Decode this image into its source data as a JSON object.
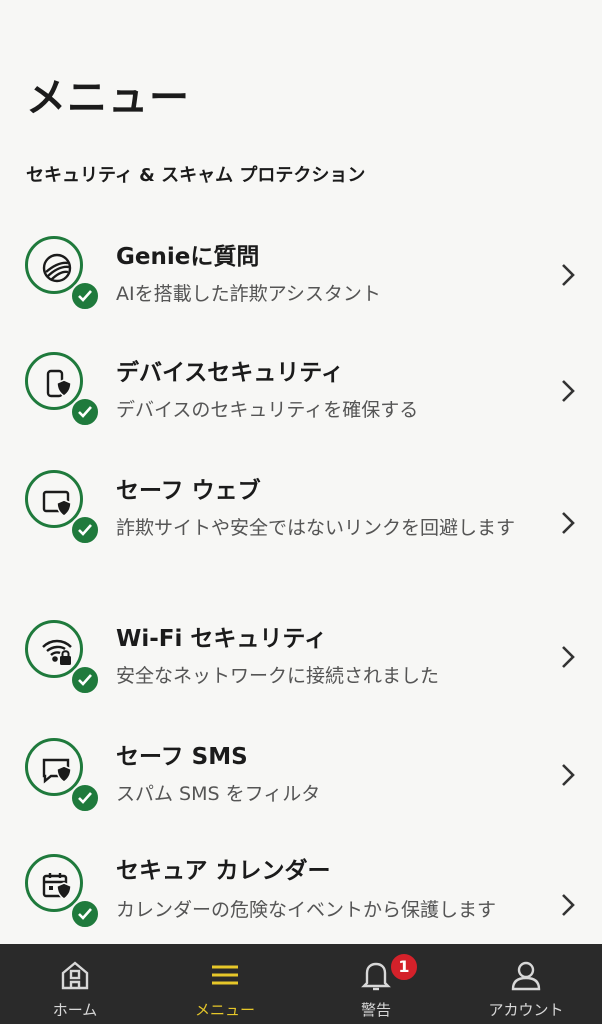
{
  "header": {
    "title": "メニュー",
    "section": "セキュリティ & スキャム プロテクション"
  },
  "colors": {
    "accent_green": "#1f7a3c",
    "nav_background": "#2a2a2a",
    "nav_active": "#e6c729",
    "badge_red": "#d4212a"
  },
  "menu": [
    {
      "title": "Genieに質問",
      "desc": "AIを搭載した詐欺アシスタント",
      "icon": "genie-icon"
    },
    {
      "title": "デバイスセキュリティ",
      "desc": "デバイスのセキュリティを確保する",
      "icon": "device-shield-icon"
    },
    {
      "title": "セーフ ウェブ",
      "desc": "詐欺サイトや安全ではないリンクを回避します",
      "icon": "web-shield-icon"
    },
    {
      "title": "Wi-Fi セキュリティ",
      "desc": "安全なネットワークに接続されました",
      "icon": "wifi-lock-icon"
    },
    {
      "title": "セーフ SMS",
      "desc": "スパム SMS をフィルタ",
      "icon": "sms-shield-icon"
    },
    {
      "title": "セキュア カレンダー",
      "desc": "カレンダーの危険なイベントから保護します",
      "icon": "calendar-shield-icon"
    }
  ],
  "nav": {
    "home": "ホーム",
    "menu": "メニュー",
    "alerts": "警告",
    "alerts_count": "1",
    "account": "アカウント",
    "active": "menu"
  }
}
